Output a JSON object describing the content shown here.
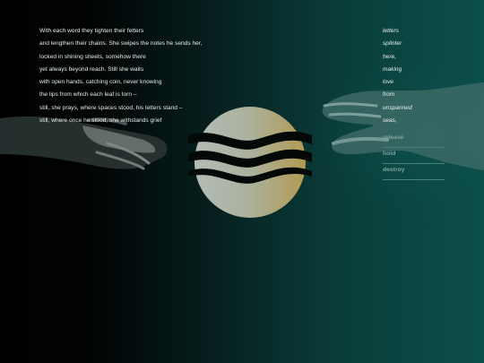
{
  "poem": {
    "lines": [
      "With each word they tighten their fetters",
      "and lengthen their chains. She swipes the notes he sends her,",
      "locked in shining sheets, somehow there",
      "yet always beyond reach. Still she waits",
      "with open hands, catching coin, never knowing",
      "the lips from which each leaf is torn –",
      "still, she prays, where spaces stood, his letters stand –",
      "still, where once he stood, she withstands grief"
    ]
  },
  "word_list": {
    "items": [
      "letters",
      "splinter",
      "here,",
      "making",
      "love",
      "from",
      "unspanned",
      "seas,"
    ]
  },
  "actions": {
    "release": "release",
    "hold": "hold",
    "destroy": "destroy"
  },
  "colors": {
    "poem_text": "#e6ecea",
    "action_text": "#7fa4a0",
    "logo_gold": "#b39a52",
    "logo_grey": "#aeb8b2",
    "bg_right": "#0b4e4a"
  },
  "icons": {
    "logo": "sun-waves-logo",
    "left_hand": "reaching-hand-left",
    "right_hand": "reaching-hand-right"
  }
}
